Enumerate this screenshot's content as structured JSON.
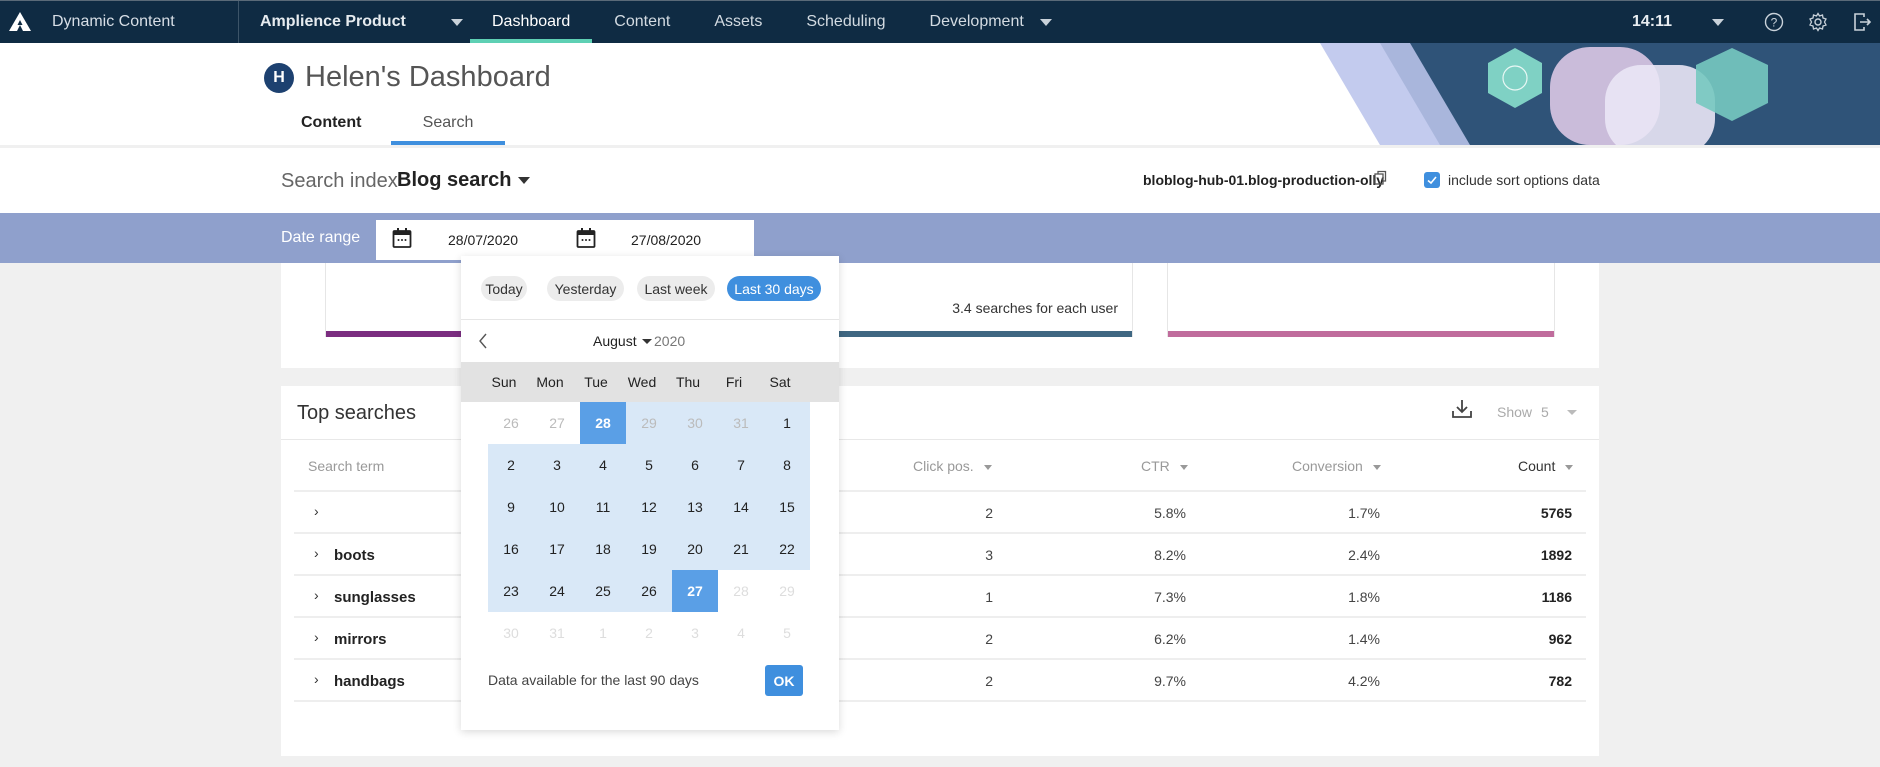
{
  "topnav": {
    "app_name": "Dynamic Content",
    "hub": "Amplience Product",
    "items": [
      {
        "label": "Dashboard",
        "active": true
      },
      {
        "label": "Content",
        "active": false
      },
      {
        "label": "Assets",
        "active": false
      },
      {
        "label": "Scheduling",
        "active": false
      },
      {
        "label": "Development",
        "active": false
      }
    ],
    "clock": "14:11",
    "icons": [
      "logo-icon",
      "help-icon",
      "settings-icon",
      "logout-icon"
    ],
    "accent": "#5ed0b4",
    "background": "#0f2b43"
  },
  "header": {
    "avatar_initial": "H",
    "title": "Helen's Dashboard",
    "tabs": [
      {
        "label": "Content",
        "active": false
      },
      {
        "label": "Search",
        "active": true
      }
    ]
  },
  "search_index": {
    "label": "Search index",
    "value": "Blog search",
    "hub_index_name": "bloblog-hub-01.blog-production-olly",
    "include_sort_label": "include sort options data",
    "include_sort_checked": true
  },
  "date_range": {
    "label": "Date range",
    "from": "28/07/2020",
    "to": "27/08/2020"
  },
  "stats": {
    "cards": [
      {
        "text": "",
        "color": "#7b2d80"
      },
      {
        "text": "3.4 searches for each user",
        "color": "#3f6782"
      },
      {
        "text": "",
        "color": "#c06c9c"
      }
    ]
  },
  "date_picker": {
    "presets": [
      {
        "label": "Today",
        "active": false
      },
      {
        "label": "Yesterday",
        "active": false
      },
      {
        "label": "Last week",
        "active": false
      },
      {
        "label": "Last 30 days",
        "active": true
      }
    ],
    "month": "August",
    "year": "2020",
    "weekdays": [
      "Sun",
      "Mon",
      "Tue",
      "Wed",
      "Thu",
      "Fri",
      "Sat"
    ],
    "weeks": [
      [
        {
          "d": "26",
          "s": "muted"
        },
        {
          "d": "27",
          "s": "muted"
        },
        {
          "d": "28",
          "s": "selected"
        },
        {
          "d": "29",
          "s": "muted-range"
        },
        {
          "d": "30",
          "s": "muted-range"
        },
        {
          "d": "31",
          "s": "muted-range"
        },
        {
          "d": "1",
          "s": "range"
        }
      ],
      [
        {
          "d": "2",
          "s": "range"
        },
        {
          "d": "3",
          "s": "range"
        },
        {
          "d": "4",
          "s": "range"
        },
        {
          "d": "5",
          "s": "range"
        },
        {
          "d": "6",
          "s": "range"
        },
        {
          "d": "7",
          "s": "range"
        },
        {
          "d": "8",
          "s": "range"
        }
      ],
      [
        {
          "d": "9",
          "s": "range"
        },
        {
          "d": "10",
          "s": "range"
        },
        {
          "d": "11",
          "s": "range"
        },
        {
          "d": "12",
          "s": "range"
        },
        {
          "d": "13",
          "s": "range"
        },
        {
          "d": "14",
          "s": "range"
        },
        {
          "d": "15",
          "s": "range"
        }
      ],
      [
        {
          "d": "16",
          "s": "range"
        },
        {
          "d": "17",
          "s": "range"
        },
        {
          "d": "18",
          "s": "range"
        },
        {
          "d": "19",
          "s": "range"
        },
        {
          "d": "20",
          "s": "range"
        },
        {
          "d": "21",
          "s": "range"
        },
        {
          "d": "22",
          "s": "range"
        }
      ],
      [
        {
          "d": "23",
          "s": "range"
        },
        {
          "d": "24",
          "s": "range"
        },
        {
          "d": "25",
          "s": "range"
        },
        {
          "d": "26",
          "s": "range"
        },
        {
          "d": "27",
          "s": "selected"
        },
        {
          "d": "28",
          "s": "faint"
        },
        {
          "d": "29",
          "s": "faint"
        }
      ],
      [
        {
          "d": "30",
          "s": "faint"
        },
        {
          "d": "31",
          "s": "faint"
        },
        {
          "d": "1",
          "s": "faint"
        },
        {
          "d": "2",
          "s": "faint"
        },
        {
          "d": "3",
          "s": "faint"
        },
        {
          "d": "4",
          "s": "faint"
        },
        {
          "d": "5",
          "s": "faint"
        }
      ]
    ],
    "footer_text": "Data available for the last 90 days",
    "ok_label": "OK",
    "accent": "#3f8fde"
  },
  "top_searches": {
    "title": "Top searches",
    "show_label": "Show",
    "show_value": "5",
    "columns": {
      "term": "Search term",
      "click": "Click pos.",
      "ctr": "CTR",
      "conversion": "Conversion",
      "count": "Count"
    },
    "rows": [
      {
        "term": "",
        "click": "2",
        "ctr": "5.8%",
        "conversion": "1.7%",
        "count": "5765"
      },
      {
        "term": "boots",
        "click": "3",
        "ctr": "8.2%",
        "conversion": "2.4%",
        "count": "1892"
      },
      {
        "term": "sunglasses",
        "click": "1",
        "ctr": "7.3%",
        "conversion": "1.8%",
        "count": "1186"
      },
      {
        "term": "mirrors",
        "click": "2",
        "ctr": "6.2%",
        "conversion": "1.4%",
        "count": "962"
      },
      {
        "term": "handbags",
        "click": "2",
        "ctr": "9.7%",
        "conversion": "4.2%",
        "count": "782"
      }
    ]
  }
}
